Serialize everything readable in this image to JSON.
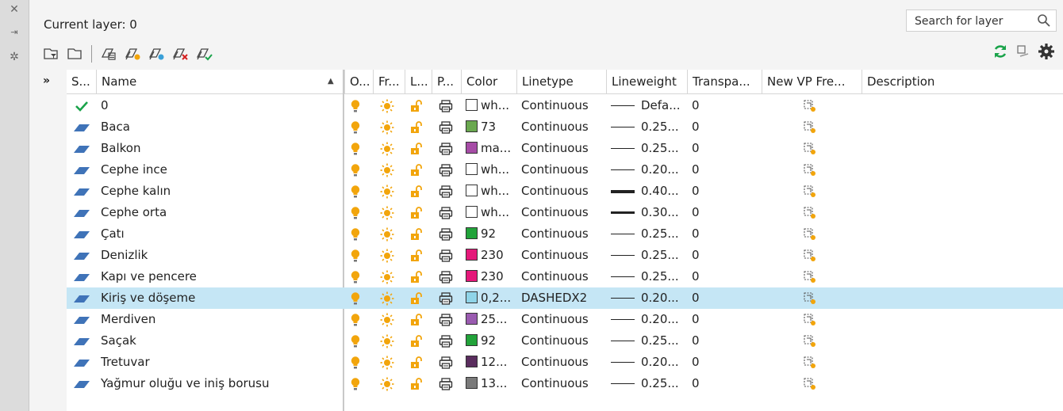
{
  "side": {
    "close_glyph": "✕",
    "pin_glyph": "⇥",
    "settings_glyph": "✲"
  },
  "header": {
    "current_layer": "Current layer: 0"
  },
  "search": {
    "placeholder": "Search for layer"
  },
  "toolbar": {
    "filter_expand": "»"
  },
  "columns": [
    {
      "key": "status",
      "label": "S..."
    },
    {
      "key": "name",
      "label": "Name"
    },
    {
      "key": "on",
      "label": "O..."
    },
    {
      "key": "freeze",
      "label": "Fr..."
    },
    {
      "key": "lock",
      "label": "L..."
    },
    {
      "key": "plot",
      "label": "P..."
    },
    {
      "key": "color",
      "label": "Color"
    },
    {
      "key": "linetype",
      "label": "Linetype"
    },
    {
      "key": "lineweight",
      "label": "Lineweight"
    },
    {
      "key": "transparency",
      "label": "Transpa..."
    },
    {
      "key": "newvp",
      "label": "New VP Fre..."
    },
    {
      "key": "description",
      "label": "Description"
    }
  ],
  "rows": [
    {
      "name": "0",
      "current": true,
      "color_label": "wh...",
      "swatch": "#ffffff",
      "linetype": "Continuous",
      "lw_label": "Defa...",
      "lw_thick": 1,
      "transparency": "0",
      "selected": false
    },
    {
      "name": "Baca",
      "current": false,
      "color_label": "73",
      "swatch": "#6aa84f",
      "linetype": "Continuous",
      "lw_label": "0.25...",
      "lw_thick": 1,
      "transparency": "0",
      "selected": false
    },
    {
      "name": "Balkon",
      "current": false,
      "color_label": "ma...",
      "swatch": "#a64ca6",
      "linetype": "Continuous",
      "lw_label": "0.25...",
      "lw_thick": 1,
      "transparency": "0",
      "selected": false
    },
    {
      "name": "Cephe  ince",
      "current": false,
      "color_label": "wh...",
      "swatch": "#ffffff",
      "linetype": "Continuous",
      "lw_label": "0.20...",
      "lw_thick": 1,
      "transparency": "0",
      "selected": false
    },
    {
      "name": "Cephe kalın",
      "current": false,
      "color_label": "wh...",
      "swatch": "#ffffff",
      "linetype": "Continuous",
      "lw_label": "0.40...",
      "lw_thick": 4,
      "transparency": "0",
      "selected": false
    },
    {
      "name": "Cephe orta",
      "current": false,
      "color_label": "wh...",
      "swatch": "#ffffff",
      "linetype": "Continuous",
      "lw_label": "0.30...",
      "lw_thick": 3,
      "transparency": "0",
      "selected": false
    },
    {
      "name": "Çatı",
      "current": false,
      "color_label": "92",
      "swatch": "#22a33a",
      "linetype": "Continuous",
      "lw_label": "0.25...",
      "lw_thick": 1,
      "transparency": "0",
      "selected": false
    },
    {
      "name": "Denizlik",
      "current": false,
      "color_label": "230",
      "swatch": "#e5187a",
      "linetype": "Continuous",
      "lw_label": "0.25...",
      "lw_thick": 1,
      "transparency": "0",
      "selected": false
    },
    {
      "name": "Kapı ve pencere",
      "current": false,
      "color_label": "230",
      "swatch": "#e5187a",
      "linetype": "Continuous",
      "lw_label": "0.25...",
      "lw_thick": 1,
      "transparency": "0",
      "selected": false
    },
    {
      "name": "Kiriş ve döşeme",
      "current": false,
      "color_label": "0,2...",
      "swatch": "#8fd4e8",
      "linetype": "DASHEDX2",
      "lw_label": "0.20...",
      "lw_thick": 1,
      "transparency": "0",
      "selected": true
    },
    {
      "name": "Merdiven",
      "current": false,
      "color_label": "25...",
      "swatch": "#9a5bb0",
      "linetype": "Continuous",
      "lw_label": "0.20...",
      "lw_thick": 1,
      "transparency": "0",
      "selected": false
    },
    {
      "name": "Saçak",
      "current": false,
      "color_label": "92",
      "swatch": "#22a33a",
      "linetype": "Continuous",
      "lw_label": "0.25...",
      "lw_thick": 1,
      "transparency": "0",
      "selected": false
    },
    {
      "name": "Tretuvar",
      "current": false,
      "color_label": "12...",
      "swatch": "#5a2d5e",
      "linetype": "Continuous",
      "lw_label": "0.20...",
      "lw_thick": 1,
      "transparency": "0",
      "selected": false
    },
    {
      "name": "Yağmur oluğu ve iniş borusu",
      "current": false,
      "color_label": "13...",
      "swatch": "#7a7a7a",
      "linetype": "Continuous",
      "lw_label": "0.25...",
      "lw_thick": 1,
      "transparency": "0",
      "selected": false
    }
  ],
  "colors": {
    "accent_green": "#1aa34a",
    "bulb": "#f2a50c",
    "sun": "#f2a50c",
    "lock": "#f2a50c",
    "selected_row": "#c5e6f5"
  },
  "icons": {
    "status_current": "check-icon",
    "status_layer": "layer-parallelogram-icon",
    "on": "lightbulb-icon",
    "freeze": "sun-icon",
    "lock": "unlocked-padlock-icon",
    "plot": "printer-icon",
    "newvp": "vp-freeze-icon"
  }
}
